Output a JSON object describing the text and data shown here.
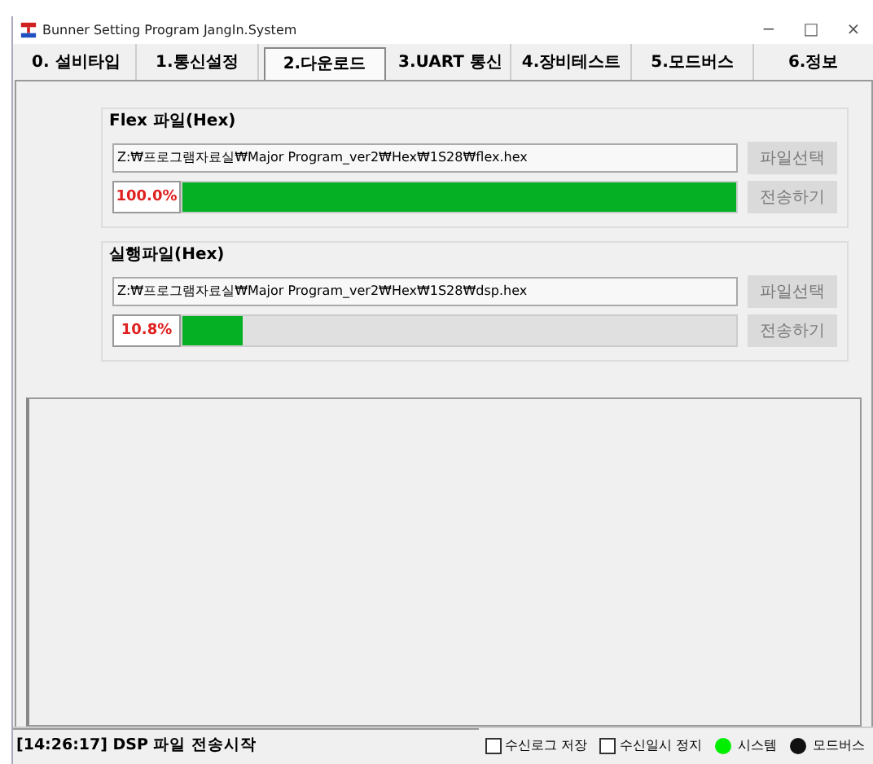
{
  "window": {
    "title": "Bunner Setting Program JangIn.System",
    "controls": [
      "−",
      "□",
      "×"
    ]
  },
  "tabs": [
    {
      "label": "0. 설비타입",
      "selected": false
    },
    {
      "label": "1.통신설정",
      "selected": false
    },
    {
      "label": "2.다운로드",
      "selected": true
    },
    {
      "label": "3.UART 통신",
      "selected": false
    },
    {
      "label": "4.장비테스트",
      "selected": false
    },
    {
      "label": "5.모드버스",
      "selected": false
    },
    {
      "label": "6.정보",
      "selected": false
    }
  ],
  "groups": [
    {
      "title": "Flex 파일(Hex)",
      "path": "Z:₩프로그램자료실₩Major Program_ver2₩Hex₩1S28₩flex.hex",
      "select_button": {
        "label": "파일선택",
        "disabled": true
      },
      "send_button": {
        "label": "전송하기",
        "disabled": true
      },
      "percent": "100.0%",
      "level": 1.0
    },
    {
      "title": "실행파일(Hex)",
      "path": "Z:₩프로그램자료실₩Major Program_ver2₩Hex₩1S28₩dsp.hex",
      "select_button": {
        "label": "파일선택",
        "disabled": true
      },
      "send_button": {
        "label": "전송하기",
        "disabled": true
      },
      "percent": "10.8%",
      "level": 0.108
    }
  ],
  "status_bar": {
    "message": "[14:26:17] DSP 파일 전송시작",
    "checkboxes": [
      {
        "label": "수신로그 저장",
        "checked": false
      },
      {
        "label": "수신일시 정지",
        "checked": false
      }
    ],
    "indicators": [
      {
        "label": "시스템",
        "color": "#00ee00"
      },
      {
        "label": "모드버스",
        "color": "#111111"
      }
    ]
  }
}
